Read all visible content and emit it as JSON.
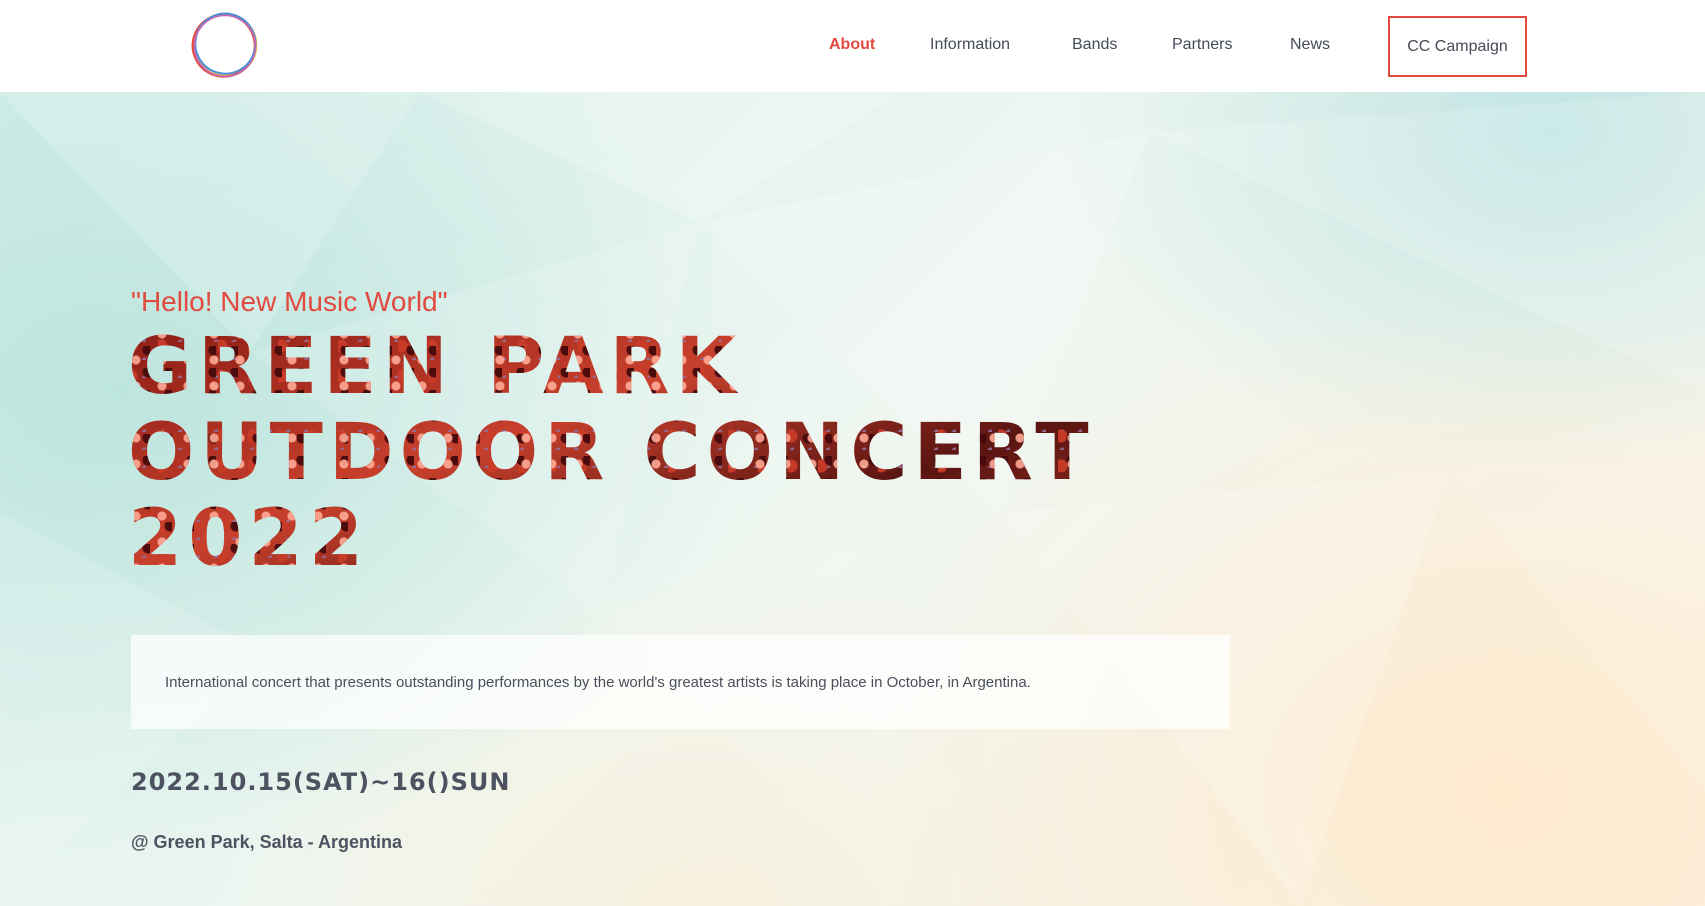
{
  "nav": {
    "logo_icon": "ring-logo-icon",
    "items": [
      {
        "label": "About",
        "active": true
      },
      {
        "label": "Information",
        "active": false
      },
      {
        "label": "Bands",
        "active": false
      },
      {
        "label": "Partners",
        "active": false
      },
      {
        "label": "News",
        "active": false
      }
    ],
    "cta_label": "CC Campaign"
  },
  "hero": {
    "tagline": "\"Hello! New Music World\"",
    "title_lines": [
      "GREEN PARK",
      "OUTDOOR CONCERT",
      "2022"
    ],
    "description": "International concert that presents outstanding performances by the world's greatest artists is taking place in October, in Argentina.",
    "date": "2022.10.15(SAT)~16()SUN",
    "venue": "@ Green Park, Salta - Argentina"
  },
  "colors": {
    "accent": "#e2493f",
    "text": "#444a57",
    "title_texture": "#8c1d16"
  }
}
